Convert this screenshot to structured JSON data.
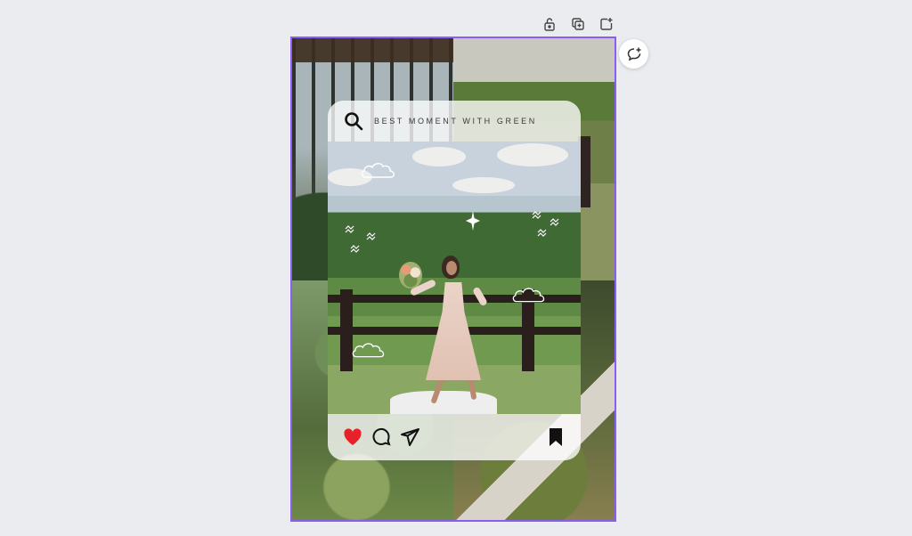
{
  "toolbar": {
    "icons": [
      "lock-icon",
      "duplicate-page-icon",
      "add-page-icon"
    ]
  },
  "comment": {
    "icon": "add-comment-icon"
  },
  "canvas": {
    "selection_color": "#8b5cf6",
    "post": {
      "header_title": "BEST MOMENT WITH GREEN",
      "actions": [
        "heart-icon",
        "comment-icon",
        "share-icon",
        "bookmark-icon"
      ],
      "heart_color": "#e8202a"
    }
  }
}
